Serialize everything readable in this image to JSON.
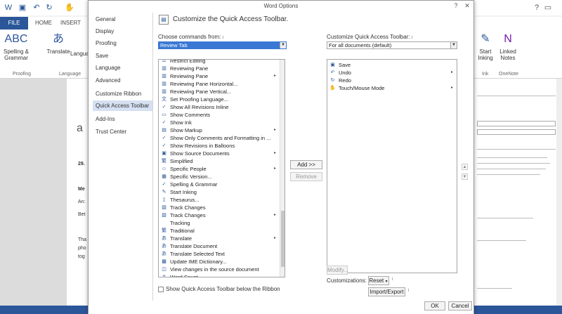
{
  "word": {
    "tabs": {
      "file": "FILE",
      "home": "HOME",
      "insert": "INSERT"
    },
    "ribbon": {
      "spelling": "Spelling &",
      "spelling2": "Grammar",
      "translate": "Translate",
      "language_btn": "Language",
      "group_proofing": "Proofing",
      "group_language": "Language",
      "start_inking": "Start",
      "start_inking2": "Inking",
      "linked_notes": "Linked",
      "linked_notes2": "Notes",
      "group_ink": "Ink",
      "group_onenote": "OneNote"
    },
    "doc": {
      "line1": "29.",
      "line2": "Me",
      "line3": "An:",
      "line4": "Bet",
      "line5": "Tha",
      "line6": "pho",
      "line7": "tog"
    }
  },
  "dialog": {
    "title": "Word Options",
    "nav": [
      "General",
      "Display",
      "Proofing",
      "Save",
      "Language",
      "Advanced",
      "Customize Ribbon",
      "Quick Access Toolbar",
      "Add-Ins",
      "Trust Center"
    ],
    "nav_selected_index": 7,
    "section_title": "Customize the Quick Access Toolbar.",
    "choose_label": "Choose commands from:",
    "choose_value": "Review Tab",
    "customize_label": "Customize Quick Access Toolbar:",
    "customize_value": "For all documents (default)",
    "commands": [
      {
        "label": "Restrict Editing",
        "icon": "shield-icon"
      },
      {
        "label": "Reviewing Pane",
        "icon": "pane-icon"
      },
      {
        "label": "Reviewing Pane",
        "icon": "pane-icon",
        "submenu": true
      },
      {
        "label": "Reviewing Pane Horizontal...",
        "icon": "pane-icon"
      },
      {
        "label": "Reviewing Pane Vertical...",
        "icon": "pane-icon"
      },
      {
        "label": "Set Proofing Language...",
        "icon": "language-icon"
      },
      {
        "label": "Show All Revisions Inline",
        "icon": "check-icon"
      },
      {
        "label": "Show Comments",
        "icon": "comment-icon"
      },
      {
        "label": "Show Ink",
        "icon": "check-icon"
      },
      {
        "label": "Show Markup",
        "icon": "markup-icon",
        "submenu": true
      },
      {
        "label": "Show Only Comments and Formatting in ...",
        "icon": "check-icon"
      },
      {
        "label": "Show Revisions in Balloons",
        "icon": "check-icon"
      },
      {
        "label": "Show Source Documents",
        "icon": "doc-icon",
        "submenu": true
      },
      {
        "label": "Simplified",
        "icon": "chinese-icon"
      },
      {
        "label": "Specific People",
        "icon": "people-icon",
        "submenu": true
      },
      {
        "label": "Specific Version...",
        "icon": "version-icon"
      },
      {
        "label": "Spelling & Grammar",
        "icon": "spelling-icon"
      },
      {
        "label": "Start Inking",
        "icon": "pen-icon"
      },
      {
        "label": "Thesaurus...",
        "icon": "book-icon"
      },
      {
        "label": "Track Changes",
        "icon": "track-icon"
      },
      {
        "label": "Track Changes",
        "icon": "track-icon",
        "submenu": true
      },
      {
        "label": "Tracking",
        "icon": ""
      },
      {
        "label": "Traditional",
        "icon": "chinese-icon"
      },
      {
        "label": "Translate",
        "icon": "translate-icon",
        "submenu": true
      },
      {
        "label": "Translate Document",
        "icon": "translate-icon"
      },
      {
        "label": "Translate Selected Text",
        "icon": "translate-icon"
      },
      {
        "label": "Update IME Dictionary...",
        "icon": "dictionary-icon"
      },
      {
        "label": "View changes in the source document",
        "icon": "view-icon"
      },
      {
        "label": "Word Count...",
        "icon": "count-icon"
      }
    ],
    "add_button": "Add >>",
    "remove_button": "Remove",
    "qat_items": [
      {
        "label": "Save",
        "icon": "save-icon"
      },
      {
        "label": "Undo",
        "icon": "undo-icon",
        "submenu": true
      },
      {
        "label": "Redo",
        "icon": "redo-icon"
      },
      {
        "label": "Touch/Mouse Mode",
        "icon": "touch-icon",
        "submenu": true
      }
    ],
    "modify_button": "Modify...",
    "customizations_label": "Customizations:",
    "reset_button": "Reset",
    "import_export_button": "Import/Export",
    "show_below_label": "Show Quick Access Toolbar below the Ribbon",
    "ok_button": "OK",
    "cancel_button": "Cancel",
    "info_glyph": "i",
    "colors": {
      "accent": "#2b579a",
      "selection": "#3a78d4",
      "nav_selected": "#d5e1f2"
    }
  }
}
